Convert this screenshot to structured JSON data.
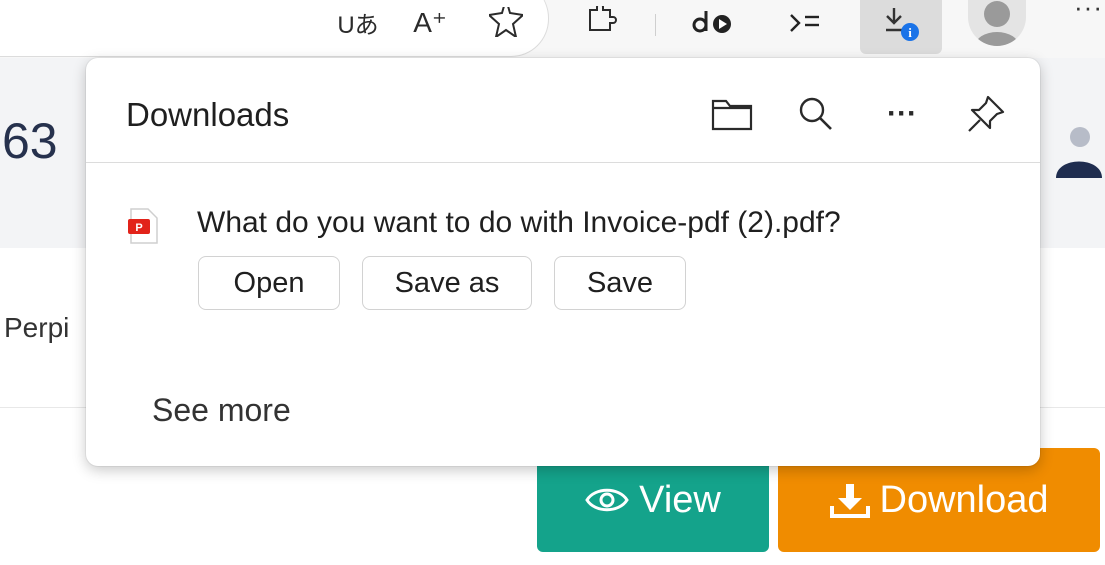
{
  "browser": {
    "toolbar_icons": [
      "read-aloud-icon",
      "text-size-icon",
      "favorite-star-icon",
      "extensions-icon",
      "media-icon",
      "collections-icon",
      "downloads-icon",
      "profile-avatar-icon",
      "more-icon"
    ],
    "read_aloud_text": "Uあ",
    "text_size_text": "A⁺",
    "more_text": "···",
    "download_badge_color": "#1a73e8"
  },
  "page": {
    "number_fragment": "63",
    "perp_fragment": "Perpi",
    "view_button": "View",
    "download_button": "Download",
    "colors": {
      "view": "#14a38b",
      "download": "#f08c00"
    }
  },
  "downloads_panel": {
    "title": "Downloads",
    "header_icons": [
      "open-folder-icon",
      "search-icon",
      "more-options-icon",
      "pin-icon"
    ],
    "more_text": "···",
    "file_icon": "pdf-file-icon",
    "prompt": "What do you want to do with Invoice-pdf (2).pdf?",
    "actions": {
      "open": "Open",
      "save_as": "Save as",
      "save": "Save"
    },
    "see_more": "See more"
  }
}
